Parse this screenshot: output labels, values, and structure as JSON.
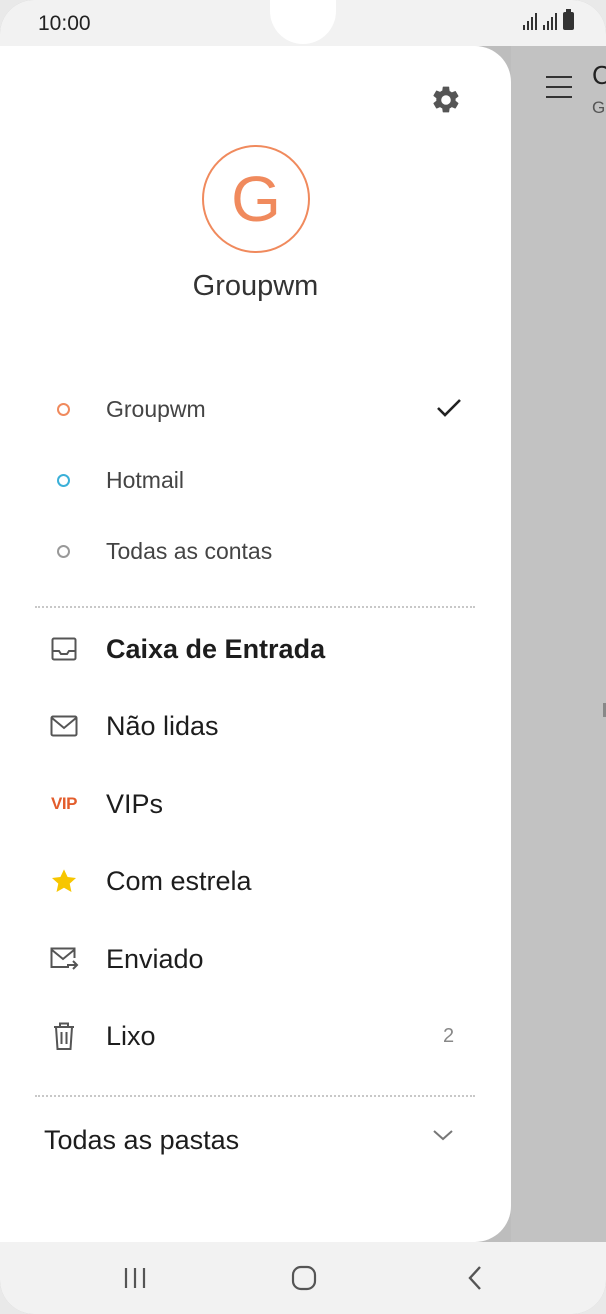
{
  "status_bar": {
    "time": "10:00"
  },
  "background_app": {
    "title_partial": "C",
    "subtitle_partial": "G"
  },
  "profile": {
    "avatar_letter": "G",
    "name": "Groupwm"
  },
  "accounts": [
    {
      "label": "Groupwm",
      "dot_color": "#f08a5d",
      "selected": true
    },
    {
      "label": "Hotmail",
      "dot_color": "#3bb0d8",
      "selected": false
    },
    {
      "label": "Todas as contas",
      "dot_color": "#999999",
      "selected": false
    }
  ],
  "folders": [
    {
      "label": "Caixa de Entrada",
      "icon": "inbox-icon",
      "bold": true,
      "count": ""
    },
    {
      "label": "Não lidas",
      "icon": "envelope-icon",
      "bold": false,
      "count": ""
    },
    {
      "label": "VIPs",
      "icon": "vip-icon",
      "icon_text": "VIP",
      "bold": false,
      "count": ""
    },
    {
      "label": "Com estrela",
      "icon": "star-icon",
      "bold": false,
      "count": ""
    },
    {
      "label": "Enviado",
      "icon": "sent-icon",
      "bold": false,
      "count": ""
    },
    {
      "label": "Lixo",
      "icon": "trash-icon",
      "bold": false,
      "count": "2"
    }
  ],
  "all_folders": {
    "label": "Todas as pastas"
  },
  "colors": {
    "accent": "#f08a5d",
    "vip": "#e35d2c",
    "star": "#f7c600"
  }
}
